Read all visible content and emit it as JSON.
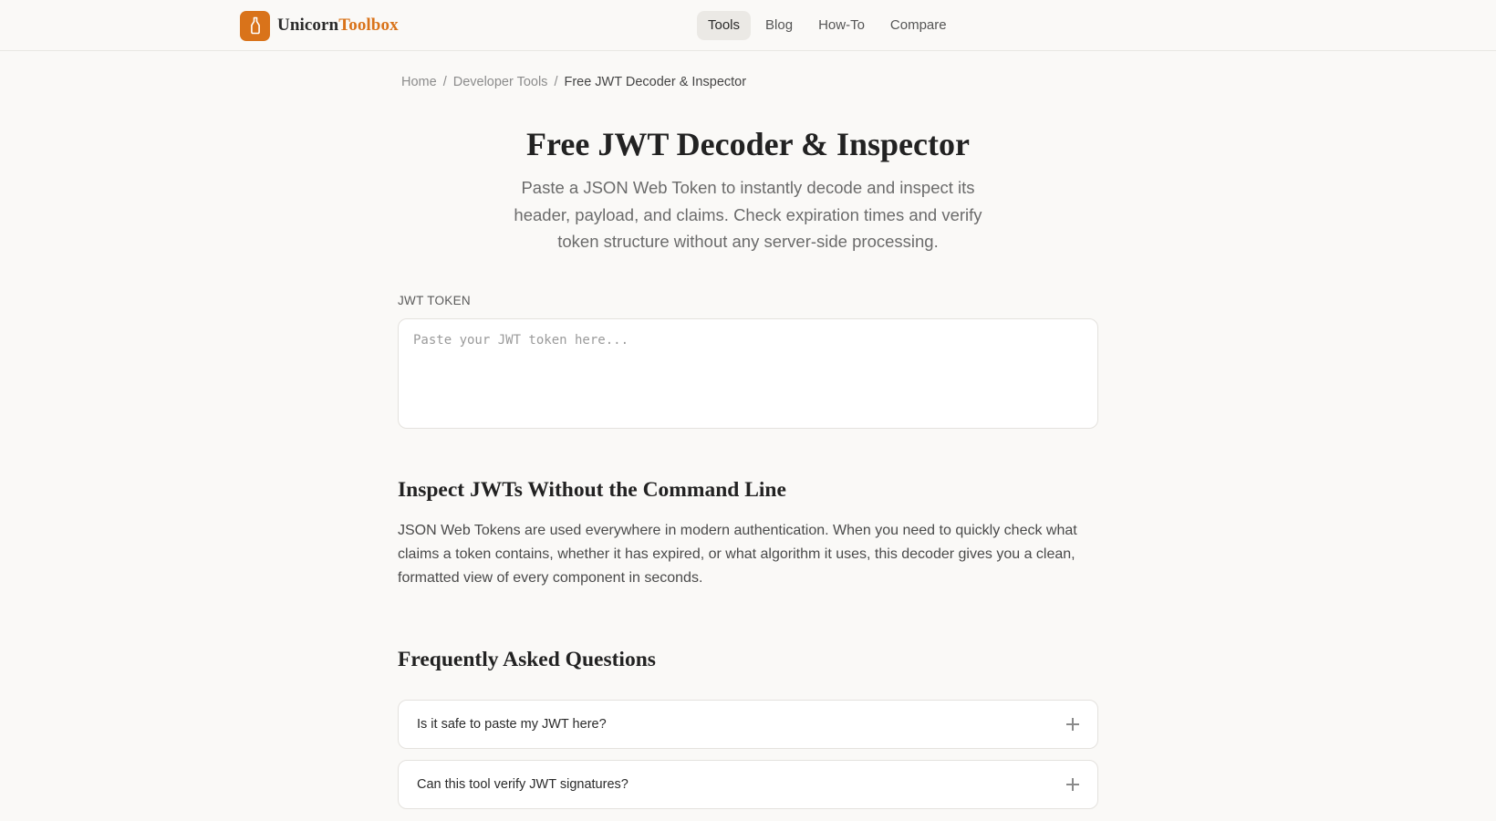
{
  "header": {
    "logo": {
      "name": "Unicorn",
      "accent": "Toolbox",
      "icon": "bottle-icon",
      "brand_color": "#d9731a"
    },
    "nav": [
      {
        "label": "Tools",
        "active": true
      },
      {
        "label": "Blog",
        "active": false
      },
      {
        "label": "How-To",
        "active": false
      },
      {
        "label": "Compare",
        "active": false
      }
    ]
  },
  "breadcrumb": {
    "home": "Home",
    "separator": "/",
    "category": "Developer Tools",
    "current": "Free JWT Decoder & Inspector"
  },
  "hero": {
    "title": "Free JWT Decoder & Inspector",
    "subtitle": "Paste a JSON Web Token to instantly decode and inspect its header, payload, and claims. Check expiration times and verify token structure without any server-side processing."
  },
  "token_field": {
    "label": "JWT TOKEN",
    "placeholder": "Paste your JWT token here...",
    "value": ""
  },
  "inspect_section": {
    "title": "Inspect JWTs Without the Command Line",
    "body": "JSON Web Tokens are used everywhere in modern authentication. When you need to quickly check what claims a token contains, whether it has expired, or what algorithm it uses, this decoder gives you a clean, formatted view of every component in seconds."
  },
  "faq": {
    "title": "Frequently Asked Questions",
    "items": [
      {
        "question": "Is it safe to paste my JWT here?",
        "icon": "plus-icon"
      },
      {
        "question": "Can this tool verify JWT signatures?",
        "icon": "plus-icon"
      }
    ]
  }
}
